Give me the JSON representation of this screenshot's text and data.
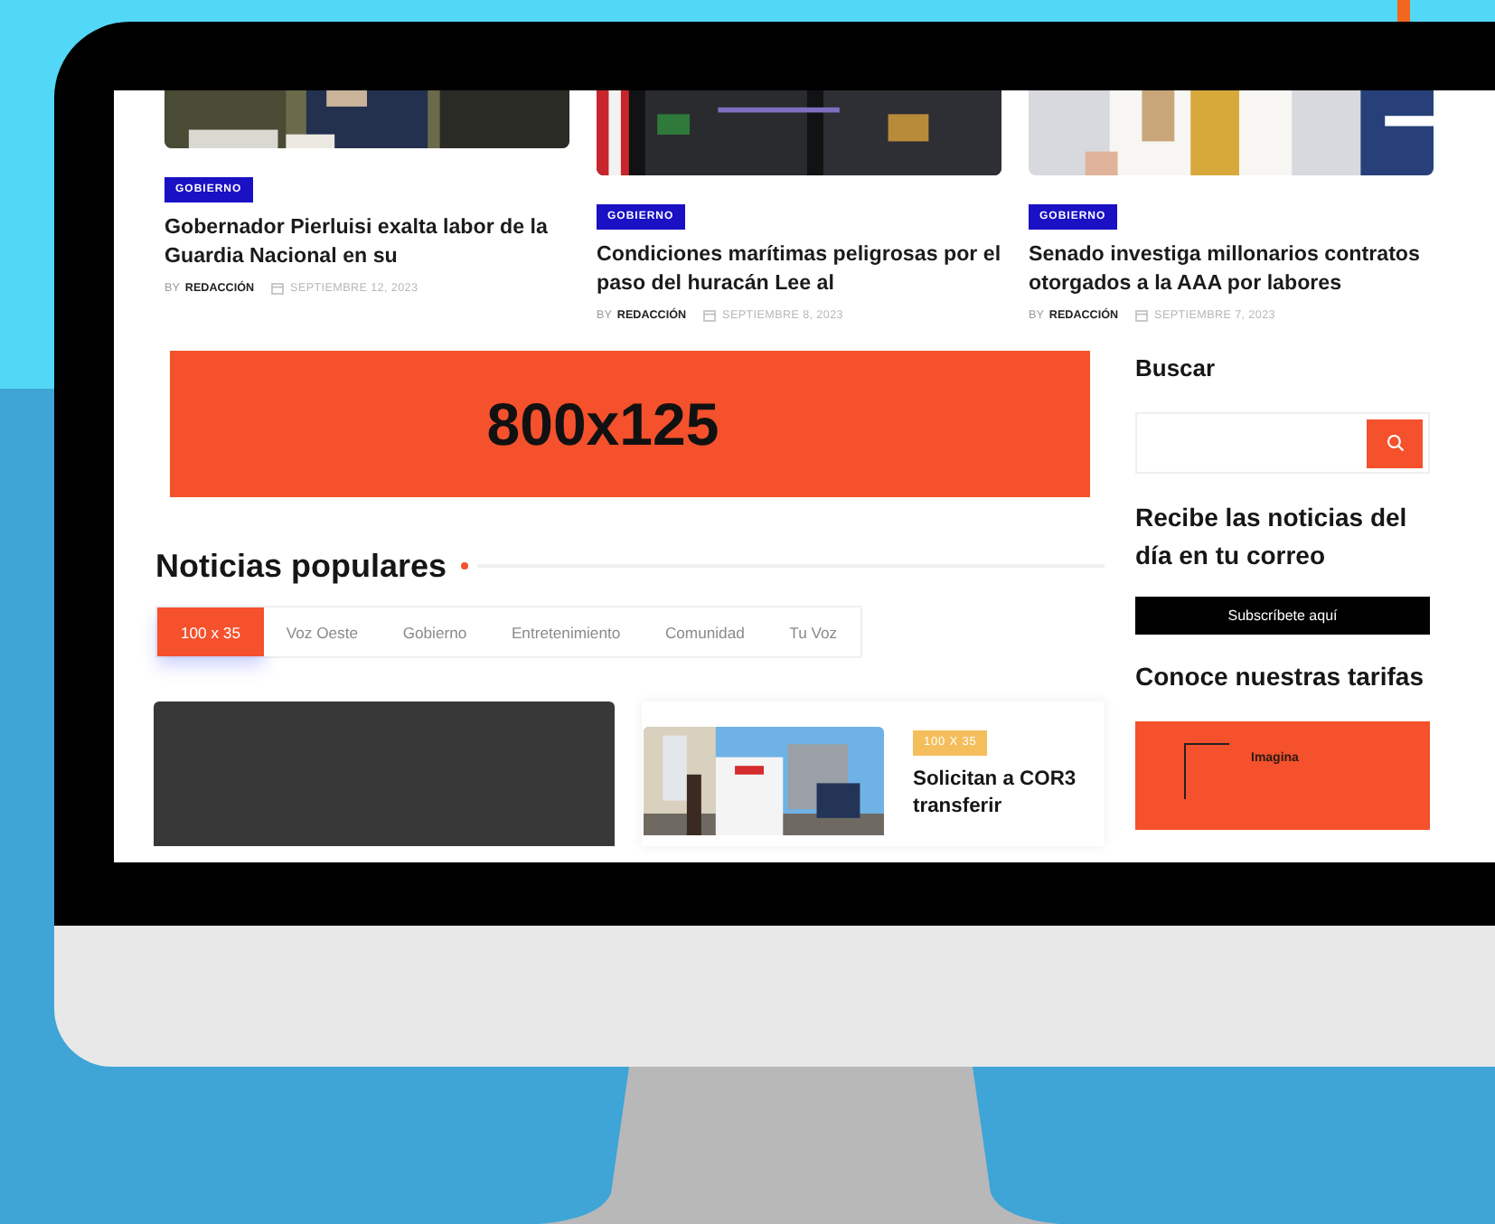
{
  "articles": [
    {
      "tag": "GOBIERNO",
      "title": "Gobernador Pierluisi exalta labor de la Guardia Nacional en su",
      "by": "BY",
      "author": "REDACCIÓN",
      "date": "SEPTIEMBRE 12, 2023"
    },
    {
      "tag": "GOBIERNO",
      "title": "Condiciones marítimas peligrosas por el paso del huracán Lee al",
      "by": "BY",
      "author": "REDACCIÓN",
      "date": "SEPTIEMBRE 8, 2023"
    },
    {
      "tag": "GOBIERNO",
      "title": "Senado investiga millonarios contratos otorgados a la AAA por labores",
      "by": "BY",
      "author": "REDACCIÓN",
      "date": "SEPTIEMBRE 7, 2023"
    }
  ],
  "ad_banner": {
    "text": "800x125"
  },
  "popular": {
    "title": "Noticias populares",
    "tabs": [
      {
        "label": "100 x 35",
        "selected": true
      },
      {
        "label": "Voz Oeste",
        "selected": false
      },
      {
        "label": "Gobierno",
        "selected": false
      },
      {
        "label": "Entretenimiento",
        "selected": false
      },
      {
        "label": "Comunidad",
        "selected": false
      },
      {
        "label": "Tu Voz",
        "selected": false
      }
    ],
    "story": {
      "tag": "100 X 35",
      "title": "Solicitan a COR3 transferir"
    }
  },
  "sidebar": {
    "search_title": "Buscar",
    "newsletter_title": "Recibe las noticias del día en tu correo",
    "subscribe_button": "Subscríbete aquí",
    "rates_title": "Conoce nuestras tarifas",
    "rates_ad": "Imagina"
  }
}
